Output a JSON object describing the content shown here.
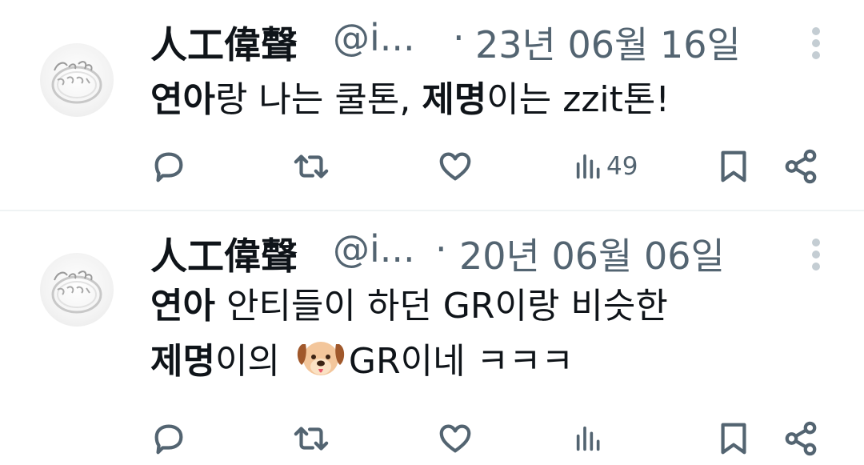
{
  "tweets": [
    {
      "display_name": "人工偉聲",
      "handle": "@i...",
      "separator": "·",
      "date": "23년 06월 16일",
      "text_parts": {
        "p1_bold": "연아",
        "p2": "랑 나는 쿨톤, ",
        "p3_bold": "제명",
        "p4": "이는 zzit톤!"
      },
      "views": "49"
    },
    {
      "display_name": "人工偉聲",
      "handle": "@i...",
      "separator": "·",
      "date": "20년 06월 06일",
      "text_parts": {
        "l1_bold": "연아",
        "l1": " 안티들이 하던 GR이랑 비슷한",
        "l2_bold": "제명",
        "l2a": "이의 ",
        "emoji": "dog-face-emoji",
        "l2b": "GR이네 ㅋㅋㅋ"
      },
      "views": ""
    }
  ],
  "icons": [
    "reply-icon",
    "retweet-icon",
    "like-icon",
    "views-icon",
    "bookmark-icon",
    "share-icon",
    "more-icon"
  ],
  "colors": {
    "text": "#0f1419",
    "muted": "#536471",
    "divider": "#eff3f4"
  }
}
